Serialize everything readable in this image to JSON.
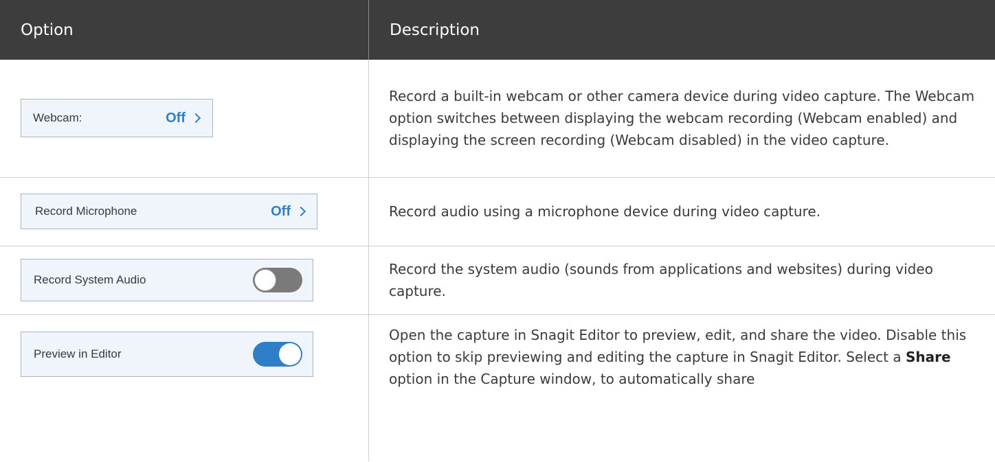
{
  "table": {
    "header": {
      "option": "Option",
      "description": "Description"
    },
    "rows": [
      {
        "widget_label": "Webcam:",
        "widget_value": "Off",
        "widget_icon": "chevron-right-icon",
        "description": "Record a built-in webcam or other camera device during video capture. The Webcam option switches between displaying the webcam recording (Webcam enabled) and displaying the screen recording (Webcam disabled) in the video capture."
      },
      {
        "widget_label": "Record Microphone",
        "widget_value": "Off",
        "widget_icon": "chevron-right-icon",
        "description": "Record audio using a microphone device during video capture."
      },
      {
        "widget_label": "Record System Audio",
        "widget_toggle": "off",
        "description": "Record the system audio (sounds from applications and websites) during video capture."
      },
      {
        "widget_label": "Preview in Editor",
        "widget_toggle": "on",
        "description_before": "Open the capture in Snagit Editor to preview, edit, and share the video. Disable this option to skip previewing and editing the capture in Snagit Editor. Select a ",
        "description_bold": "Share",
        "description_after": " option in the Capture window, to automatically share"
      }
    ]
  },
  "colors": {
    "header_bg": "#3d3d3d",
    "accent_blue": "#2f7fc8",
    "widget_bg": "#f0f4fb",
    "toggle_off": "#7a7a7a"
  }
}
